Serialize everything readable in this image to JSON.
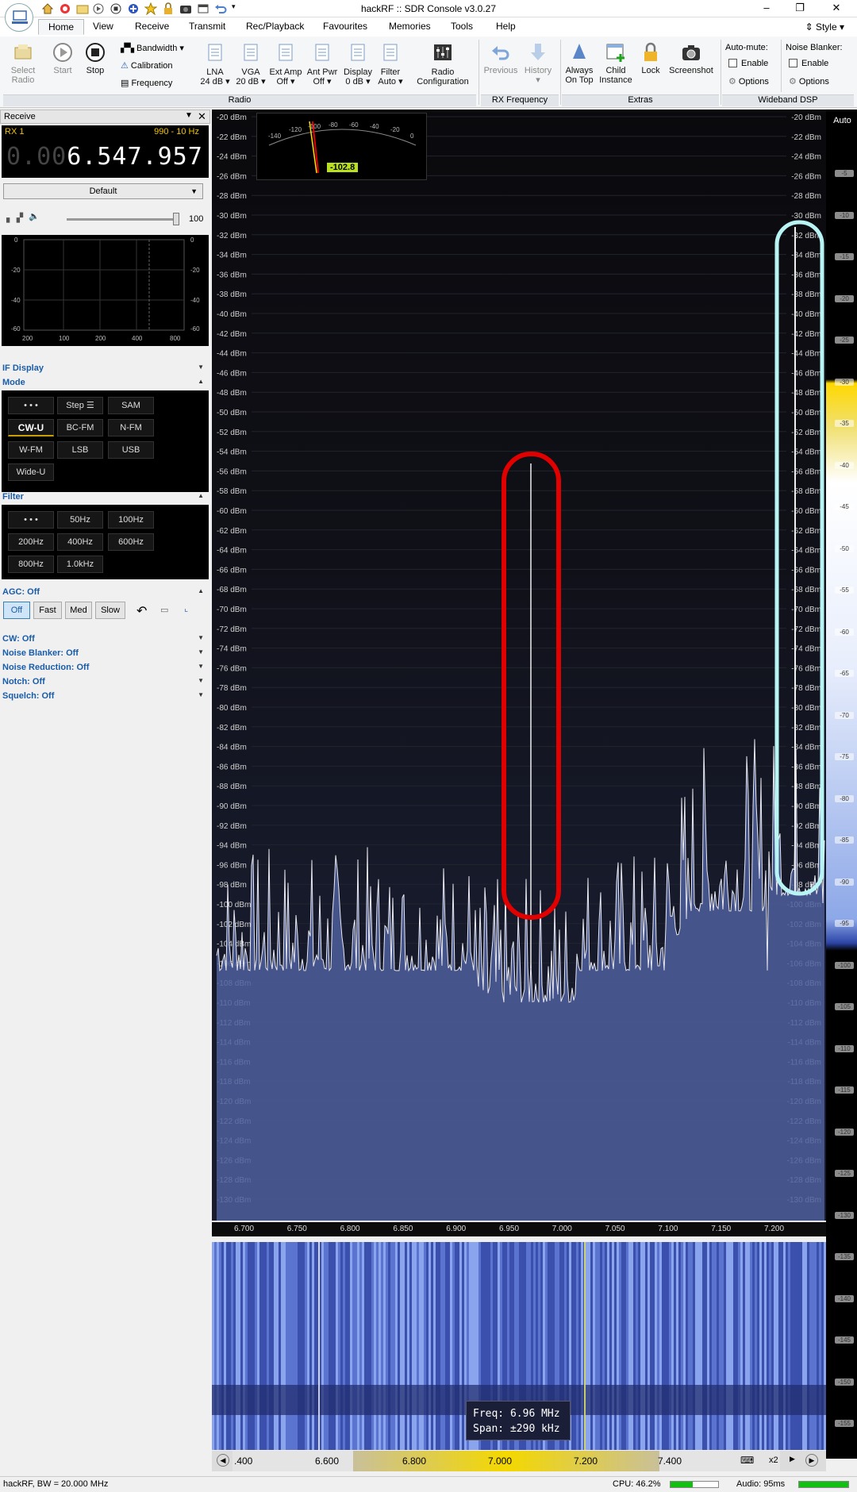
{
  "window": {
    "title": "hackRF :: SDR Console v3.0.27",
    "style_label": "Style"
  },
  "tabs": [
    "Home",
    "View",
    "Receive",
    "Transmit",
    "Rec/Playback",
    "Favourites",
    "Memories",
    "Tools",
    "Help"
  ],
  "ribbon": {
    "select_radio": "Select\nRadio",
    "start": "Start",
    "stop": "Stop",
    "bandwidth": "Bandwidth",
    "calibration": "Calibration",
    "frequency": "Frequency",
    "lna": {
      "label": "LNA",
      "value": "24 dB"
    },
    "vga": {
      "label": "VGA",
      "value": "20 dB"
    },
    "ext_amp": {
      "label": "Ext Amp",
      "value": "Off"
    },
    "ant_pwr": {
      "label": "Ant Pwr",
      "value": "Off"
    },
    "display": {
      "label": "Display",
      "value": "0 dB"
    },
    "filter": {
      "label": "Filter",
      "value": "Auto"
    },
    "radio_config": "Radio\nConfiguration",
    "group_radio": "Radio",
    "previous": "Previous",
    "history": "History",
    "group_rx_freq": "RX Frequency",
    "always_on_top": "Always\nOn Top",
    "child_instance": "Child\nInstance",
    "lock": "Lock",
    "screenshot": "Screenshot",
    "group_extras": "Extras",
    "auto_mute": "Auto-mute:",
    "noise_blanker": "Noise Blanker:",
    "enable": "Enable",
    "options": "Options",
    "group_wideband": "Wideband DSP"
  },
  "receive_panel": {
    "title": "Receive",
    "rx": "RX 1",
    "range": "990 - 10 Hz",
    "freq_dim": "0.00",
    "freq_main": "6.547.957",
    "preset": "Default",
    "volume": "100",
    "audio_scope_y_left": [
      "0",
      "-20",
      "-40",
      "-60"
    ],
    "audio_scope_y_right": [
      "0",
      "-20",
      "-40",
      "-60"
    ],
    "audio_scope_x": [
      "200",
      "100",
      "200",
      "400",
      "800"
    ]
  },
  "if_display": "IF Display",
  "mode": {
    "title": "Mode",
    "buttons": [
      "• • •",
      "Step ☰",
      "SAM",
      "CW-U",
      "BC-FM",
      "N-FM",
      "W-FM",
      "LSB",
      "USB",
      "Wide-U"
    ],
    "active": "CW-U"
  },
  "filter": {
    "title": "Filter",
    "buttons": [
      "• • •",
      "50Hz",
      "100Hz",
      "200Hz",
      "400Hz",
      "600Hz",
      "800Hz",
      "1.0kHz"
    ]
  },
  "agc": {
    "title": "AGC: Off",
    "buttons": [
      "Off",
      "Fast",
      "Med",
      "Slow"
    ],
    "active": "Off"
  },
  "collapsed_sections": [
    "CW: Off",
    "Noise Blanker: Off",
    "Noise Reduction: Off",
    "Notch: Off",
    "Squelch: Off"
  ],
  "spectrum": {
    "smeter_scale": [
      "-140",
      "-120",
      "-100",
      "-80",
      "-60",
      "-40",
      "-20",
      "0"
    ],
    "smeter_value": "-102.8",
    "dbm_labels": [
      "-20 dBm",
      "-22 dBm",
      "-24 dBm",
      "-26 dBm",
      "-28 dBm",
      "-30 dBm",
      "-32 dBm",
      "-34 dBm",
      "-36 dBm",
      "-38 dBm",
      "-40 dBm",
      "-42 dBm",
      "-44 dBm",
      "-46 dBm",
      "-48 dBm",
      "-50 dBm",
      "-52 dBm",
      "-54 dBm",
      "-56 dBm",
      "-58 dBm",
      "-60 dBm",
      "-62 dBm",
      "-64 dBm",
      "-66 dBm",
      "-68 dBm",
      "-70 dBm",
      "-72 dBm",
      "-74 dBm",
      "-76 dBm",
      "-78 dBm",
      "-80 dBm",
      "-82 dBm",
      "-84 dBm",
      "-86 dBm",
      "-88 dBm",
      "-90 dBm",
      "-92 dBm",
      "-94 dBm",
      "-96 dBm",
      "-98 dBm",
      "-100 dBm",
      "-102 dBm",
      "-104 dBm",
      "-106 dBm",
      "-108 dBm",
      "-110 dBm",
      "-112 dBm",
      "-114 dBm",
      "-116 dBm",
      "-118 dBm",
      "-120 dBm",
      "-122 dBm",
      "-124 dBm",
      "-126 dBm",
      "-128 dBm",
      "-130 dBm"
    ],
    "freq_labels": [
      "6.700",
      "6.750",
      "6.800",
      "6.850",
      "6.900",
      "6.950",
      "7.000",
      "7.050",
      "7.100",
      "7.150",
      "7.200"
    ],
    "red_marker_color": "#e00000",
    "cyan_marker_color": "#b8f4f4"
  },
  "waterfall": {
    "tooltip_freq": "Freq: 6.96 MHz",
    "tooltip_span": "Span: ±290 kHz",
    "freq_labels": [
      ".400",
      "6.600",
      "6.800",
      "7.000",
      "7.200",
      "7.400"
    ],
    "zoom": "x2"
  },
  "right_scale": {
    "auto": "Auto",
    "ticks": [
      "-5",
      "-10",
      "-15",
      "-20",
      "-25",
      "-30",
      "-35",
      "-40",
      "-45",
      "-50",
      "-55",
      "-60",
      "-65",
      "-70",
      "-75",
      "-80",
      "-85",
      "-90",
      "-95",
      "-100",
      "-105",
      "-110",
      "-115",
      "-120",
      "-125",
      "-130",
      "-135",
      "-140",
      "-145",
      "-150",
      "-155"
    ]
  },
  "statusbar": {
    "left": "hackRF, BW = 20.000 MHz",
    "cpu": "CPU: 46.2%",
    "cpu_fraction": 0.46,
    "audio": "Audio: 95ms",
    "audio_fraction": 1.0
  }
}
